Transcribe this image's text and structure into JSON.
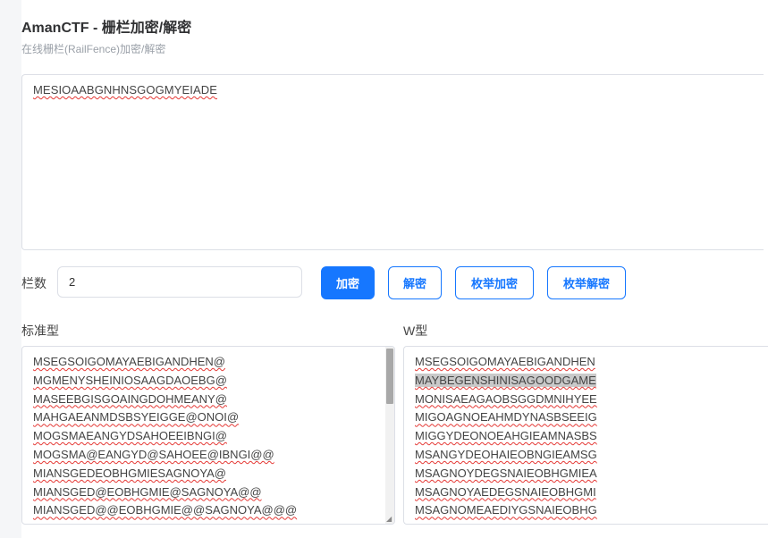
{
  "header": {
    "title": "AmanCTF - 栅栏加密/解密",
    "subtitle": "在线栅栏(RailFence)加密/解密"
  },
  "input": {
    "text": "MESIOAABGNHNSGOGMYEIADE"
  },
  "controls": {
    "rails_label": "栏数",
    "rails_value": "2",
    "encrypt_label": "加密",
    "decrypt_label": "解密",
    "brute_encrypt_label": "枚举加密",
    "brute_decrypt_label": "枚举解密"
  },
  "standard": {
    "label": "标准型",
    "lines": [
      "MSEGSOIGOMAYAEBIGANDHEN@",
      "MGMENYSHEINIOSAAGDAOEBG@",
      "MASEEBGISGOAINGDOHMEANY@",
      "MAHGAEANMDSBSYEIGGE@ONOI@",
      "MOGSMAEANGYDSAHOEEIBNGI@",
      "MOGSMA@EANGYD@SAHOEE@IBNGI@@",
      "MIANSGEDEOBHGMIESAGNOYA@",
      "MIANSGED@EOBHGMIE@SAGNOYA@@",
      "MIANSGED@@EOBHGMIE@@SAGNOYA@@@"
    ]
  },
  "wtype": {
    "label": "W型",
    "lines": [
      "MSEGSOIGOMAYAEBIGANDHEN",
      "MAYBEGENSHINISAGOODGAME",
      "MONISAEAGAOBSGGDMNIHYEE",
      "MIGOAGNOEAHMDYNASBSEEIG",
      "MIGGYDEONOEAHGIEAMNASBS",
      "MSANGYDEOHAIEOBNGIEAMSG",
      "MSAGNOYDEGSNAIEOBHGMIEA",
      "MSAGNOYAEDEGSNAIEOBHGMI",
      "MSAGNOMEAEDIYGSNAIEOBHG"
    ]
  }
}
